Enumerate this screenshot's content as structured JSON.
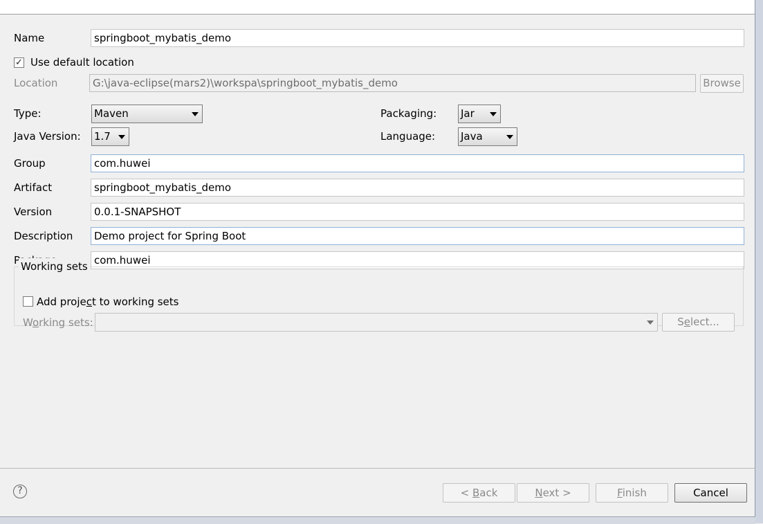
{
  "form": {
    "name_label": "Name",
    "name_value": "springboot_mybatis_demo",
    "use_default_location_label": "Use default location",
    "use_default_location_checked": true,
    "location_label": "Location",
    "location_value": "G:\\java-eclipse(mars2)\\workspa\\springboot_mybatis_demo",
    "browse_label": "Browse",
    "type_label": "Type:",
    "type_value": "Maven",
    "packaging_label": "Packaging:",
    "packaging_value": "Jar",
    "java_version_label": "Java Version:",
    "java_version_value": "1.7",
    "language_label": "Language:",
    "language_value": "Java",
    "group_label": "Group",
    "group_value": "com.huwei",
    "artifact_label": "Artifact",
    "artifact_value": "springboot_mybatis_demo",
    "version_label": "Version",
    "version_value": "0.0.1-SNAPSHOT",
    "description_label": "Description",
    "description_value": "Demo project for Spring Boot",
    "package_label": "Package",
    "package_value": "com.huwei"
  },
  "working_sets": {
    "title": "Working sets",
    "add_label_pre": "Add proje",
    "add_label_mnemonic": "c",
    "add_label_post": "t to working sets",
    "add_checked": false,
    "sets_label_pre": "W",
    "sets_label_mnemonic": "o",
    "sets_label_post": "rking sets:",
    "sets_value": "",
    "select_pre": "S",
    "select_mnemonic": "e",
    "select_post": "lect..."
  },
  "footer": {
    "help_glyph": "?",
    "back_pre": "< ",
    "back_mnemonic": "B",
    "back_post": "ack",
    "next_mnemonic": "N",
    "next_post": "ext >",
    "finish_mnemonic": "F",
    "finish_post": "inish",
    "cancel_label": "Cancel"
  },
  "check_glyph": "✓"
}
